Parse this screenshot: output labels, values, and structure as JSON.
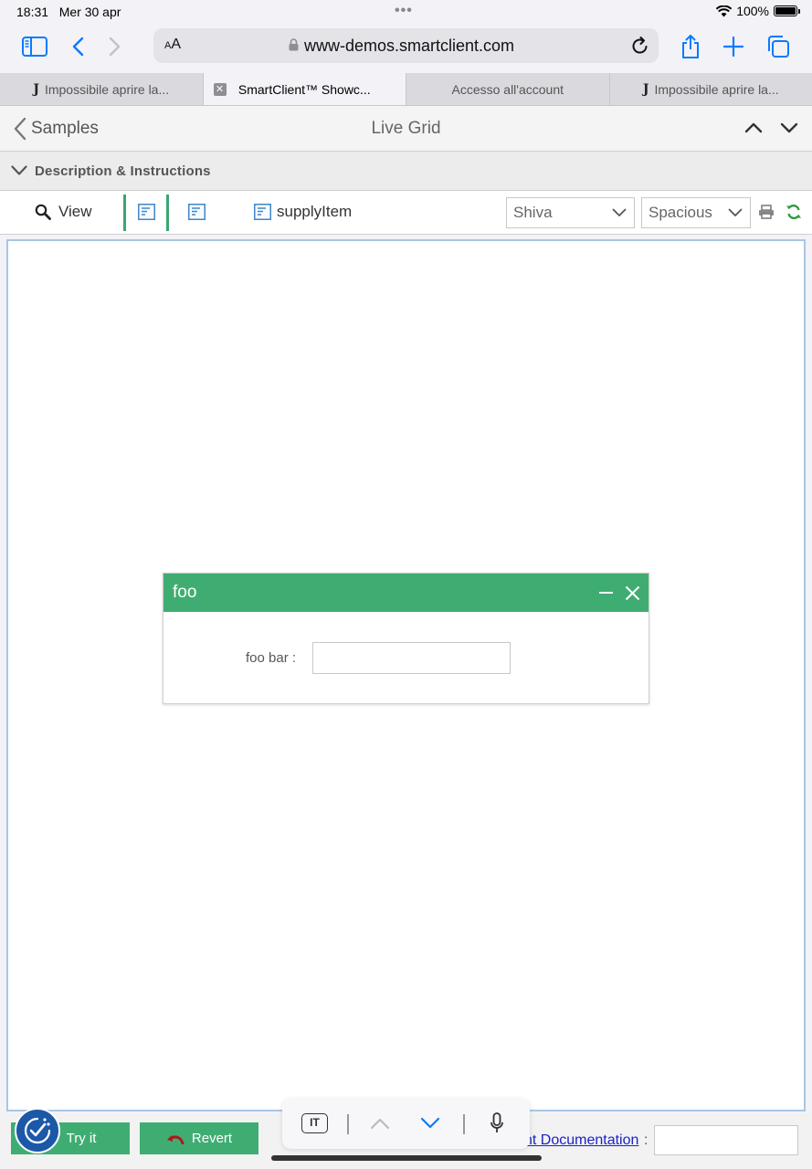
{
  "status": {
    "time": "18:31",
    "date": "Mer 30 apr",
    "battery": "100%",
    "battery_level": 1.0
  },
  "browser": {
    "aa_small": "A",
    "aa_large": "A",
    "url": "www-demos.smartclient.com",
    "tabs": [
      {
        "label": "Impossibile aprire la...",
        "icon": "juventus-logo"
      },
      {
        "label": "SmartClient™ Showc...",
        "icon": "close-icon"
      },
      {
        "label": "Accesso all'account"
      },
      {
        "label": "Impossibile aprire la...",
        "icon": "juventus-logo"
      }
    ]
  },
  "header": {
    "back_label": "Samples",
    "title": "Live Grid"
  },
  "description": {
    "label": "Description & Instructions"
  },
  "grid_toolbar": {
    "view_label": "View",
    "supply_label": "supplyItem",
    "skin_select": "Shiva",
    "density_select": "Spacious"
  },
  "dialog": {
    "title": "foo",
    "field_label": "foo bar :",
    "field_value": ""
  },
  "bottom": {
    "try_label": "Try it",
    "revert_label": "Revert",
    "doc_link": "nt Documentation",
    "doc_colon": ":",
    "keyboard_lang": "IT"
  },
  "colors": {
    "accent_green": "#3fad72",
    "link_blue": "#0a7aff"
  }
}
